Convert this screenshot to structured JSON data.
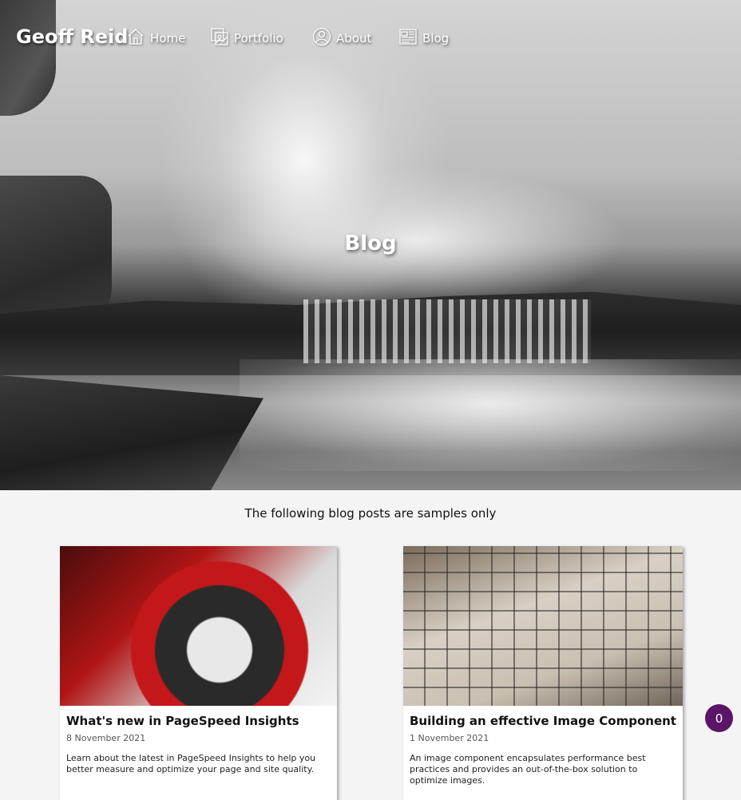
{
  "nav": {
    "brand": "Geoff Reid",
    "items": [
      {
        "label": "Home",
        "icon": "home-icon"
      },
      {
        "label": "Portfolio",
        "icon": "portfolio-icon"
      },
      {
        "label": "About",
        "icon": "user-icon"
      },
      {
        "label": "Blog",
        "icon": "newspaper-icon"
      }
    ]
  },
  "hero": {
    "title": "Blog"
  },
  "intro": "The following blog posts are samples only",
  "posts": [
    {
      "title": "What's new in PageSpeed Insights",
      "date": "8 November 2021",
      "excerpt": "Learn about the latest in PageSpeed Insights to help you better measure and optimize your page and site quality."
    },
    {
      "title": "Building an effective Image Component",
      "date": "1 November 2021",
      "excerpt": "An image component encapsulates performance best practices and provides an out-of-the-box solution to optimize images."
    }
  ],
  "badge": {
    "count": "0",
    "color": "#5b1568"
  }
}
